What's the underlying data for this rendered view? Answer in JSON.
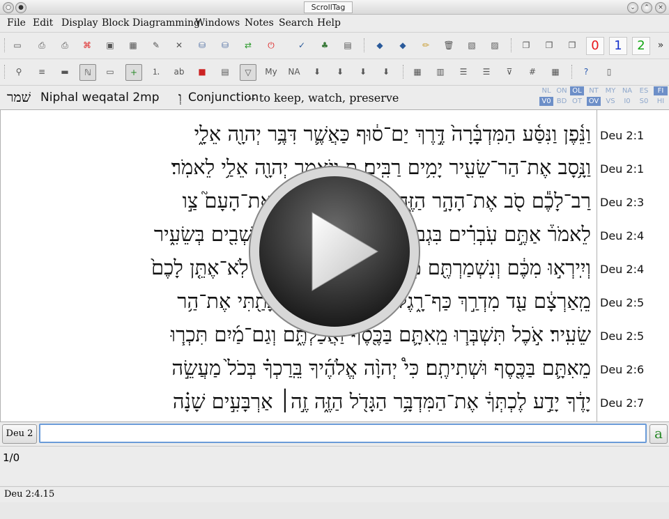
{
  "window": {
    "title": "ScrollTag"
  },
  "menu": [
    "File",
    "Edit",
    "Display",
    "Block Diagramming",
    "Windows",
    "Notes",
    "Search",
    "Help"
  ],
  "toolbar1": {
    "icons": [
      "scroll-icon",
      "print-icon",
      "print-preview-icon",
      "pdf-icon",
      "save-disk-icon",
      "chart-icon",
      "magic-wand-icon",
      "tools-icon",
      "database-download-icon",
      "database-upload-icon",
      "sync-icon",
      "power-icon",
      "ok-check-icon",
      "tree-icon",
      "document-icon",
      "bookmark-icon",
      "bookmark-add-icon",
      "pencil-icon",
      "trash-icon",
      "image-icon",
      "image-edit-icon",
      "copy-icon",
      "copy-doc-icon",
      "copy-page-icon"
    ],
    "numbers": [
      {
        "label": "0",
        "color": "#e8161a"
      },
      {
        "label": "1",
        "color": "#1733cc"
      },
      {
        "label": "2",
        "color": "#14a614"
      }
    ],
    "overflow": "»"
  },
  "toolbar2": {
    "icons": [
      "zoom-icon",
      "list-icon",
      "line-icon",
      "word-select-icon",
      "note-icon",
      "add-icon",
      "numbered-list-icon",
      "ab-icon",
      "color-mark-icon",
      "text-icon",
      "filter-icon",
      "my-icon",
      "nas-icon",
      "arrow-down-icon",
      "arrow-down2-icon",
      "arrow-down3-icon",
      "arrow-down4-icon",
      "table-icon",
      "table2-icon",
      "outline-icon",
      "outline2-icon",
      "filter2-icon",
      "grid-icon",
      "table3-icon",
      "help-icon",
      "book-icon"
    ]
  },
  "info": {
    "lexeme": "שׁמר",
    "parse": "Niphal weqatal 2mp",
    "conj_glyph": "וְ",
    "conj": "Conjunction",
    "gloss": "-- to keep, watch, preserve"
  },
  "modes_top": [
    "NL",
    "ON",
    "OL",
    "NT",
    "MY",
    "NA",
    "ES",
    "FI"
  ],
  "modes_bottom": [
    "V0",
    "BD",
    "OT",
    "OV",
    "VS",
    "I0",
    "S0",
    "HI"
  ],
  "lines": [
    {
      "ref": "Deu 2:1",
      "text": "וַנֵּ֫פֶן וַנִּסַּ֫ע הַמִּדְבָּ֫רָה֙ דֶּ֣רֶךְ יַם־ס֔וּף כַּאֲשֶׁ֛ר דִּבֶּ֥ר יְהוָ֖ה אֵלָ֑י"
    },
    {
      "ref": "Deu 2:1",
      "text": "וַנָּ֥סָב אֶת־הַר־שֵׂעִ֖יר יָמִ֥ים רַבִּֽים׃ ס וַיֹּ֥אמֶר יְהוָ֖ה אֵלַ֥י לֵאמֹֽר׃"
    },
    {
      "ref": "Deu 2:3",
      "text": "רַב־לָכֶ֕ם סֹ֖ב אֶת־הָהָ֣ר הַזֶּ֑ה פְּנ֥וּ לָכֶ֖ם צָפֹֽנָה׃ וְאֶת־הָעָם֮ צַ֣ו"
    },
    {
      "ref": "Deu 2:4",
      "text": "לֵאמֹר֒ אַתֶּ֣ם עֹֽבְרִ֗ים בִּגְבוּל֙ אֲחֵיכֶ֣ם בְּנֵי־עֵשָׂ֔ו הַיֹּשְׁבִ֖ים בְּשֵׂעִ֑יר"
    },
    {
      "ref": "Deu 2:4",
      "text": "וְיִֽירְא֣וּ מִכֶּ֔ם וְנִשְׁמַרְתֶּ֖ם מְאֹֽד׃ אַל־תִּתְגָּר֣וּ בָ֔ם כִּ֠י לֹֽא־אֶתֵּ֤ן לָכֶם֙"
    },
    {
      "ref": "Deu 2:5",
      "text": "מֵֽאַרְצָ֔ם עַ֖ד מִדְרַ֣ךְ כַּף־רָ֑גֶל כִּֽי־יְרֻשָּׁ֣ה לְעֵשָׂ֔ו נָתַ֖תִּי אֶת־הַ֥ר"
    },
    {
      "ref": "Deu 2:5",
      "text": "שֵׂעִֽיר׃ אֹ֣כֶל תִּשְׁבְּר֧וּ מֵֽאִתָּ֛ם בַּכֶּ֖סֶף וַאֲכַלְתֶּ֑ם וְגַם־מַ֜יִם תִּכְר֧וּ"
    },
    {
      "ref": "Deu 2:6",
      "text": "מֵאִתָּ֛ם בַּכֶּ֖סֶף וּשְׁתִיתֶֽם׃ כִּי֩ יְהוָ֨ה אֱלֹהֶ֜יךָ בֵּֽרַכְךָ֗ בְּכֹל֙ מַעֲשֵׂ֣ה"
    },
    {
      "ref": "Deu 2:7",
      "text": "יָדֶ֔ךָ יָדַ֣ע לֶכְתְּךָ֔ אֶת־הַמִּדְבָּ֥ר הַגָּדֹ֖ל הַזֶּ֑ה זֶ֣ה׀ אַרְבָּעִ֣ים שָׁנָ֗ה"
    }
  ],
  "colors": {
    "red_hl": "#fde0e0",
    "blue_hl": "#e0e4fa",
    "green_hl": "#e2fae2",
    "yellow_hl": "#fdf4d6",
    "pink_hl": "#fcdfe6",
    "red_text": "#e0161a",
    "blue_text": "#2a3bd6",
    "green_text": "#35b43a",
    "magenta_text": "#c41aa8",
    "orange_text": "#f5a000"
  },
  "bottom": {
    "ref_button": "Deu 2",
    "search_value": "",
    "search_button": "a",
    "results_count": "1/0"
  },
  "status": "Deu 2:4.15"
}
